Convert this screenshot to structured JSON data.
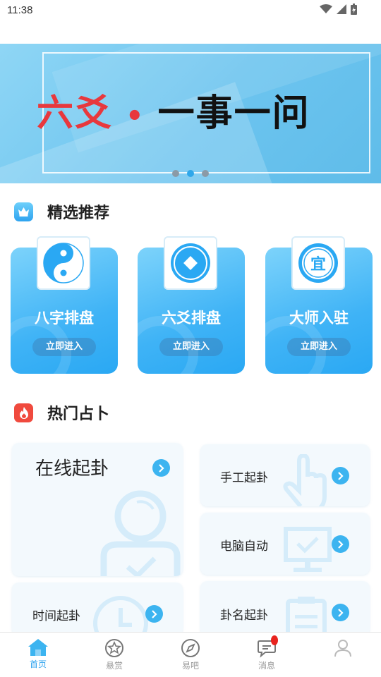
{
  "status_bar": {
    "time": "11:38"
  },
  "banner": {
    "title_part1": "六爻",
    "title_dot": "•",
    "title_part2": "一事一问",
    "page_count": 3,
    "active_page": 2
  },
  "featured": {
    "title": "精选推荐",
    "cards": [
      {
        "label": "八字排盘",
        "button": "立即进入",
        "icon": "yin-yang-icon"
      },
      {
        "label": "六爻排盘",
        "button": "立即进入",
        "icon": "coin-icon"
      },
      {
        "label": "大师入驻",
        "button": "立即进入",
        "icon": "yi-seal-icon",
        "icon_text": "宜"
      }
    ]
  },
  "hot": {
    "title": "热门占卜",
    "items": [
      {
        "label": "在线起卦",
        "icon": "person-icon"
      },
      {
        "label": "手工起卦",
        "icon": "hand-pointer-icon"
      },
      {
        "label": "电脑自动",
        "icon": "monitor-icon"
      },
      {
        "label": "时间起卦",
        "icon": "clock-icon"
      },
      {
        "label": "卦名起卦",
        "icon": "clipboard-icon"
      }
    ]
  },
  "bottom_nav": {
    "items": [
      {
        "label": "首页",
        "icon": "home-icon",
        "active": true
      },
      {
        "label": "悬赏",
        "icon": "star-icon",
        "active": false
      },
      {
        "label": "易吧",
        "icon": "compass-icon",
        "active": false
      },
      {
        "label": "消息",
        "icon": "chat-icon",
        "active": false
      },
      {
        "label": "",
        "icon": "user-icon",
        "active": false
      }
    ]
  },
  "colors": {
    "accent": "#2ea3ef",
    "banner_red": "#e8383d",
    "card_blue": "#3fb3f6",
    "hot_icon_red": "#f04a3e"
  }
}
